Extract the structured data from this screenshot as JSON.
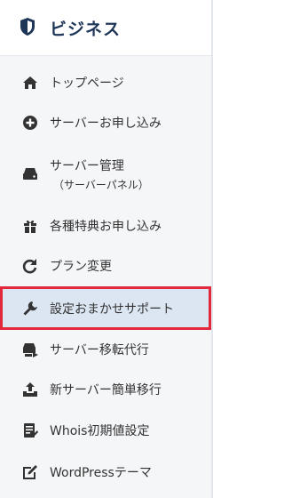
{
  "brand": {
    "title": "ビジネス",
    "icon": "shield-icon"
  },
  "menu": [
    {
      "label": "トップページ",
      "icon": "home-icon"
    },
    {
      "label": "サーバーお申し込み",
      "icon": "plus-circle-icon"
    },
    {
      "label": "サーバー管理",
      "sublabel": "（サーバーパネル）",
      "icon": "server-icon"
    },
    {
      "label": "各種特典お申し込み",
      "icon": "gift-icon"
    },
    {
      "label": "プラン変更",
      "icon": "refresh-icon"
    },
    {
      "label": "設定おまかせサポート",
      "icon": "wrench-icon",
      "active": true
    },
    {
      "label": "サーバー移転代行",
      "icon": "server-transfer-icon"
    },
    {
      "label": "新サーバー簡単移行",
      "icon": "upload-icon"
    },
    {
      "label": "Whois初期値設定",
      "icon": "document-edit-icon"
    },
    {
      "label": "WordPressテーマ",
      "icon": "edit-box-icon"
    }
  ],
  "colors": {
    "active_border": "#e3283c",
    "active_background": "#dbe6f2",
    "brand_text": "#1d3557"
  }
}
